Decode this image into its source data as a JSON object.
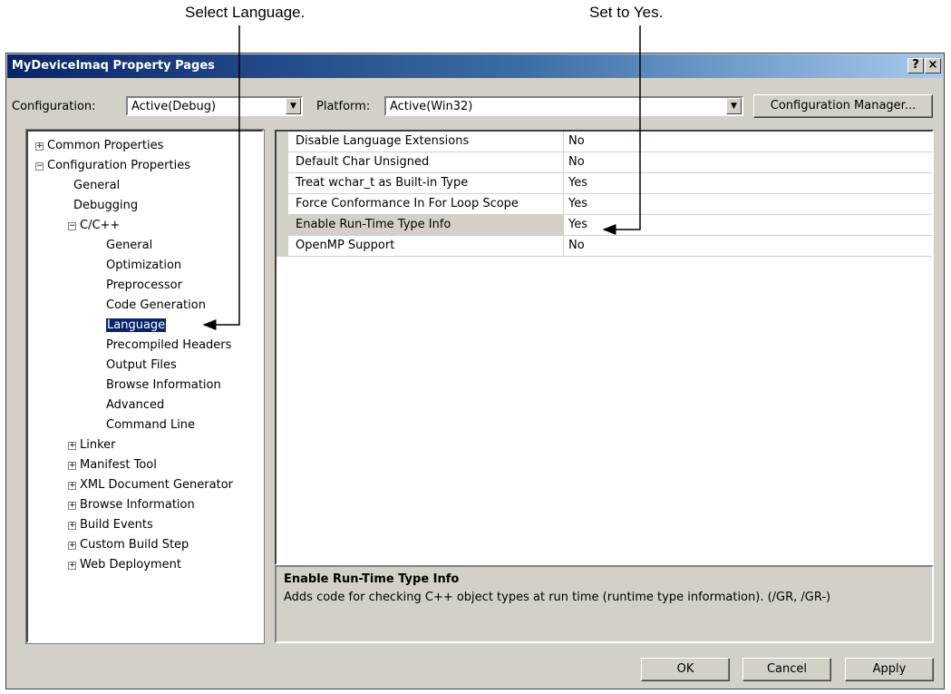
{
  "callouts": {
    "select_language": "Select Language.",
    "set_to_yes": "Set to Yes."
  },
  "window": {
    "title": "MyDeviceImaq Property Pages",
    "help_label": "?",
    "close_label": "×"
  },
  "config": {
    "configuration_label": "Configuration:",
    "configuration_value": "Active(Debug)",
    "platform_label": "Platform:",
    "platform_value": "Active(Win32)",
    "manager_button": "Configuration Manager..."
  },
  "tree": [
    {
      "label": "Common Properties",
      "expander": "+"
    },
    {
      "label": "Configuration Properties",
      "expander": "−"
    },
    {
      "label": "General"
    },
    {
      "label": "Debugging"
    },
    {
      "label": "C/C++",
      "expander": "−"
    },
    {
      "label": "General"
    },
    {
      "label": "Optimization"
    },
    {
      "label": "Preprocessor"
    },
    {
      "label": "Code Generation"
    },
    {
      "label": "Language",
      "selected": true
    },
    {
      "label": "Precompiled Headers"
    },
    {
      "label": "Output Files"
    },
    {
      "label": "Browse Information"
    },
    {
      "label": "Advanced"
    },
    {
      "label": "Command Line"
    },
    {
      "label": "Linker",
      "expander": "+"
    },
    {
      "label": "Manifest Tool",
      "expander": "+"
    },
    {
      "label": "XML Document Generator",
      "expander": "+"
    },
    {
      "label": "Browse Information",
      "expander": "+"
    },
    {
      "label": "Build Events",
      "expander": "+"
    },
    {
      "label": "Custom Build Step",
      "expander": "+"
    },
    {
      "label": "Web Deployment",
      "expander": "+"
    }
  ],
  "properties": [
    {
      "name": "Disable Language Extensions",
      "value": "No"
    },
    {
      "name": "Default Char Unsigned",
      "value": "No"
    },
    {
      "name": "Treat wchar_t as Built-in Type",
      "value": "Yes"
    },
    {
      "name": "Force Conformance In For Loop Scope",
      "value": "Yes"
    },
    {
      "name": "Enable Run-Time Type Info",
      "value": "Yes",
      "active": true
    },
    {
      "name": "OpenMP Support",
      "value": "No"
    }
  ],
  "description": {
    "title": "Enable Run-Time Type Info",
    "text": "Adds code for checking C++ object types at run time (runtime type information).     (/GR, /GR-)"
  },
  "buttons": {
    "ok": "OK",
    "cancel": "Cancel",
    "apply": "Apply"
  }
}
